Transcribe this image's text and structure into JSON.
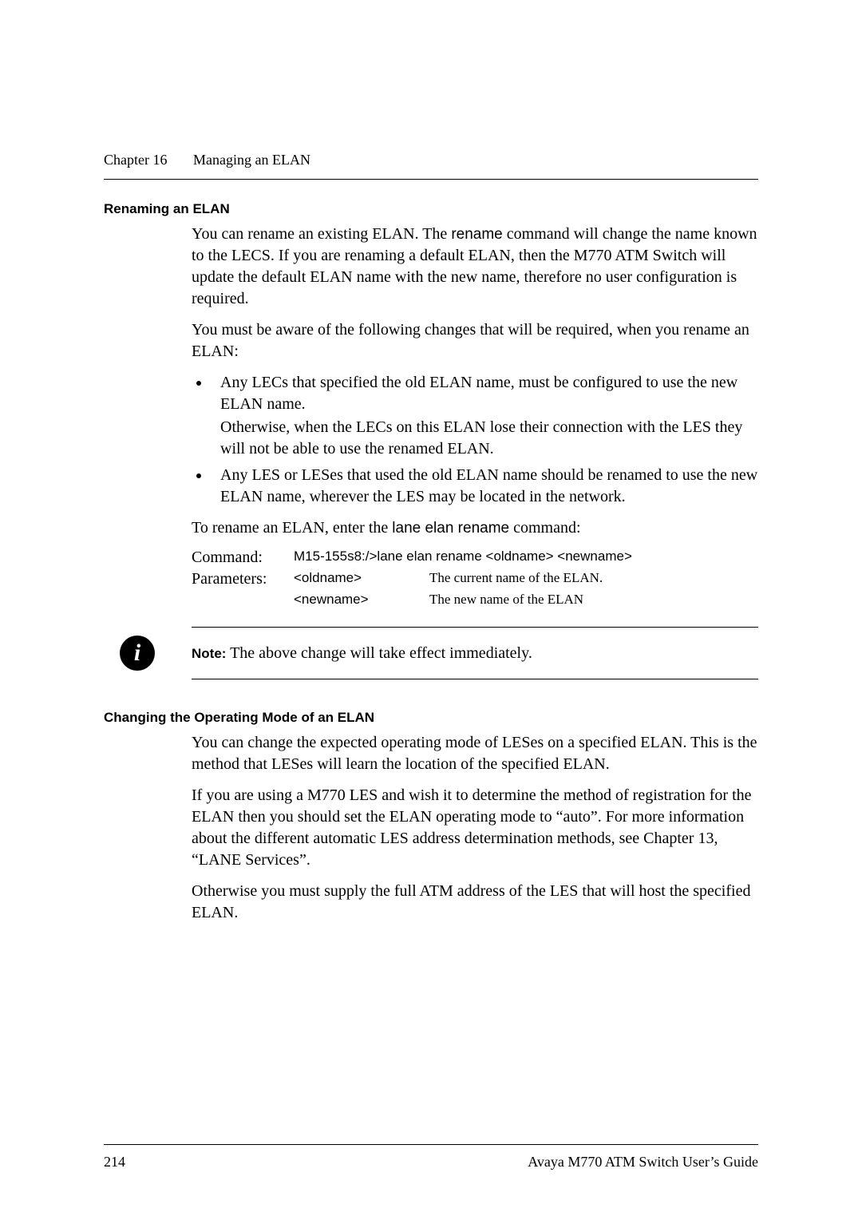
{
  "header": {
    "chapter_label": "Chapter 16",
    "chapter_title": "Managing an ELAN"
  },
  "section1": {
    "heading": "Renaming an ELAN",
    "para1_pre": "You can rename an existing ELAN. The ",
    "para1_cmd": "rename",
    "para1_post": " command will change the name known to the LECS. If you are renaming a default ELAN, then the M770 ATM Switch will update the default ELAN name with the new name, therefore no user configuration is required.",
    "para2": "You must be aware of the following changes that will be required, when you rename an ELAN:",
    "bullet1_line1": "Any LECs that specified the old ELAN name, must be configured to use the new ELAN name.",
    "bullet1_line2": "Otherwise, when the LECs on this ELAN lose their connection with the LES they will not be able to use the renamed ELAN.",
    "bullet2": "Any LES or LESes that used the old ELAN name should be renamed to use the new ELAN name, wherever the LES may be located in the network.",
    "para3_pre": "To rename an ELAN, enter the ",
    "para3_cmd": "lane elan rename",
    "para3_post": " command:",
    "cmd_label": "Command:",
    "cmd_value": "M15-155s8:/>lane elan rename <oldname> <newname>",
    "param_label": "Parameters:",
    "params": [
      {
        "name": "<oldname>",
        "desc": "The current name of the ELAN."
      },
      {
        "name": "<newname>",
        "desc": "The new name of the ELAN"
      }
    ]
  },
  "note": {
    "label": "Note:",
    "text": " The above change will take effect immediately."
  },
  "section2": {
    "heading": "Changing the Operating Mode of an ELAN",
    "para1": "You can change the expected operating mode of LESes on a specified ELAN. This is the method that LESes will learn the location of the specified ELAN.",
    "para2": "If you are using a M770 LES and wish it to determine the method of registration for the ELAN then you should set the ELAN operating mode to “auto”. For more information about the different automatic LES address determination methods, see Chapter 13, “LANE Services”.",
    "para3": "Otherwise you must supply the full ATM address of the LES that will host the specified ELAN."
  },
  "footer": {
    "page_number": "214",
    "doc_title": "Avaya M770 ATM Switch User’s Guide"
  }
}
